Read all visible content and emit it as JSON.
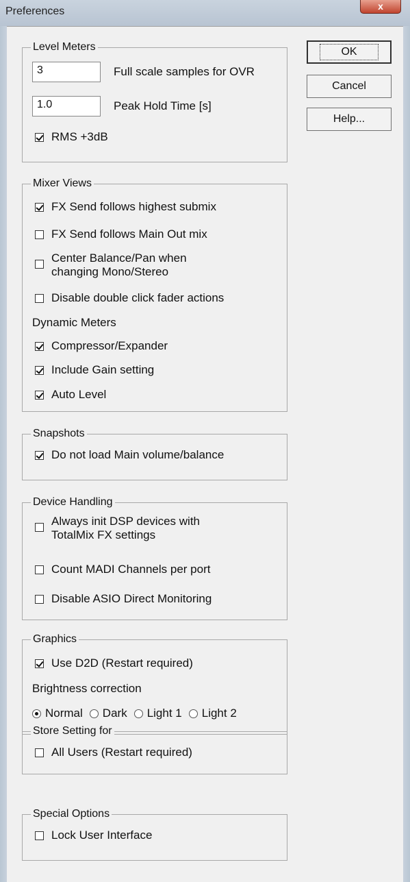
{
  "window": {
    "title": "Preferences",
    "close_label": "x"
  },
  "buttons": {
    "ok": "OK",
    "cancel": "Cancel",
    "help": "Help..."
  },
  "level_meters": {
    "title": "Level Meters",
    "full_scale_value": "3",
    "full_scale_label": "Full scale samples for OVR",
    "peak_hold_value": "1.0",
    "peak_hold_label": "Peak Hold Time [s]",
    "rms_label": "RMS +3dB",
    "rms_checked": true
  },
  "mixer_views": {
    "title": "Mixer Views",
    "items": [
      {
        "label": "FX Send follows highest submix",
        "checked": true
      },
      {
        "label": "FX Send follows Main Out mix",
        "checked": false
      },
      {
        "label": "Center Balance/Pan when changing Mono/Stereo",
        "checked": false
      },
      {
        "label": "Disable double click fader actions",
        "checked": false
      }
    ],
    "dynamic_meters_label": "Dynamic Meters",
    "dynamic_items": [
      {
        "label": "Compressor/Expander",
        "checked": true
      },
      {
        "label": "Include Gain setting",
        "checked": true
      },
      {
        "label": "Auto Level",
        "checked": true
      }
    ]
  },
  "snapshots": {
    "title": "Snapshots",
    "items": [
      {
        "label": "Do not load Main volume/balance",
        "checked": true
      }
    ]
  },
  "device_handling": {
    "title": "Device Handling",
    "items": [
      {
        "label": "Always init DSP devices with TotalMix FX settings",
        "checked": false
      },
      {
        "label": "Count MADI Channels per port",
        "checked": false
      },
      {
        "label": "Disable ASIO Direct Monitoring",
        "checked": false
      }
    ]
  },
  "graphics": {
    "title": "Graphics",
    "use_d2d_label": "Use D2D (Restart required)",
    "use_d2d_checked": true,
    "brightness_label": "Brightness correction",
    "brightness_options": [
      "Normal",
      "Dark",
      "Light 1",
      "Light 2"
    ],
    "brightness_selected": "Normal"
  },
  "store_setting": {
    "title": "Store Setting for",
    "items": [
      {
        "label": "All Users (Restart required)",
        "checked": false
      }
    ]
  },
  "special_options": {
    "title": "Special Options",
    "items": [
      {
        "label": "Lock User Interface",
        "checked": false
      }
    ]
  }
}
